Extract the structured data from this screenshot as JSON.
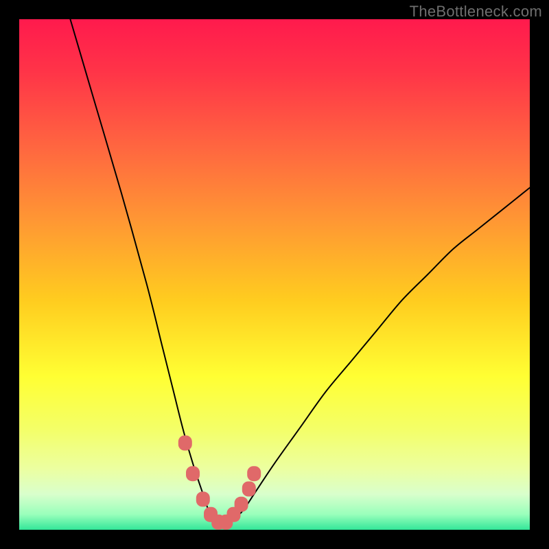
{
  "watermark": "TheBottleneck.com",
  "colors": {
    "frame": "#000000",
    "watermark_text": "#6f6f6f",
    "curve_stroke": "#000000",
    "marker_fill": "#e06969",
    "gradient_stops": [
      {
        "offset": 0.0,
        "color": "#ff1a4d"
      },
      {
        "offset": 0.1,
        "color": "#ff3348"
      },
      {
        "offset": 0.25,
        "color": "#ff6640"
      },
      {
        "offset": 0.4,
        "color": "#ff9933"
      },
      {
        "offset": 0.55,
        "color": "#ffcc1f"
      },
      {
        "offset": 0.7,
        "color": "#ffff33"
      },
      {
        "offset": 0.8,
        "color": "#f4ff66"
      },
      {
        "offset": 0.88,
        "color": "#ecffa0"
      },
      {
        "offset": 0.93,
        "color": "#d9ffcc"
      },
      {
        "offset": 0.97,
        "color": "#99ffbb"
      },
      {
        "offset": 1.0,
        "color": "#33e699"
      }
    ]
  },
  "chart_data": {
    "type": "line",
    "title": "",
    "xlabel": "",
    "ylabel": "",
    "xlim": [
      0,
      100
    ],
    "ylim": [
      0,
      100
    ],
    "series": [
      {
        "name": "bottleneck-curve",
        "x": [
          10,
          15,
          20,
          25,
          28,
          30,
          32,
          34,
          36,
          37,
          38,
          39,
          40,
          42,
          44,
          46,
          50,
          55,
          60,
          65,
          70,
          75,
          80,
          85,
          90,
          95,
          100
        ],
        "y": [
          100,
          83,
          66,
          48,
          36,
          28,
          20,
          13,
          7,
          4,
          2,
          1,
          1,
          2,
          4,
          7,
          13,
          20,
          27,
          33,
          39,
          45,
          50,
          55,
          59,
          63,
          67
        ]
      }
    ],
    "markers": {
      "name": "highlight-region",
      "x": [
        32.5,
        34,
        36,
        37.5,
        39,
        40.5,
        42,
        43.5,
        45,
        46
      ],
      "y": [
        17,
        11,
        6,
        3,
        1.5,
        1.5,
        3,
        5,
        8,
        11
      ]
    }
  }
}
